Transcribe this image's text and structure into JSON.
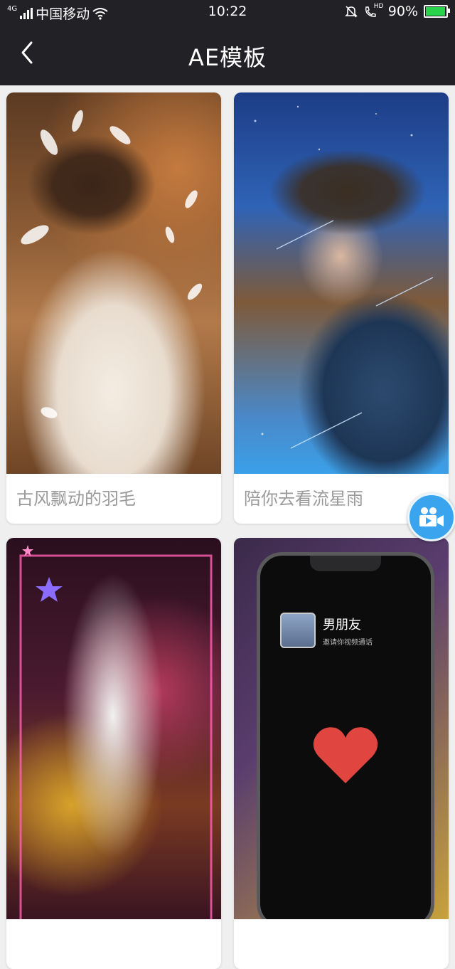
{
  "status_bar": {
    "network": "4G",
    "carrier": "中国移动",
    "time": "10:22",
    "hd_label": "HD",
    "battery_percent": "90%",
    "battery_level": 0.9,
    "battery_color": "#27d34a"
  },
  "nav": {
    "title": "AE模板",
    "back_icon": "chevron-left-icon"
  },
  "templates": [
    {
      "caption": "古风飘动的羽毛"
    },
    {
      "caption": "陪你去看流星雨"
    },
    {
      "caption": ""
    },
    {
      "caption": "",
      "phone_contact_name": "男朋友",
      "phone_contact_status": "邀请你视频通话"
    }
  ],
  "fab": {
    "icon": "video-camera-icon",
    "color": "#3aa5ee"
  },
  "colors": {
    "header_bg": "#222226",
    "page_bg": "#efefef",
    "caption_text": "#9a9a9a"
  }
}
